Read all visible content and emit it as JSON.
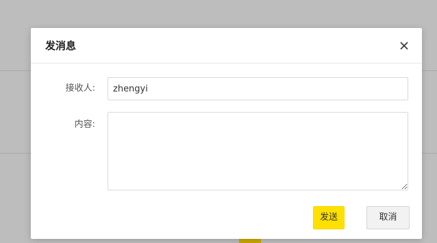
{
  "dialog": {
    "title": "发消息",
    "close_icon": "close-icon"
  },
  "form": {
    "recipient_label": "接收人:",
    "recipient_value": "zhengyi",
    "content_label": "内容:",
    "content_value": ""
  },
  "buttons": {
    "send_label": "发送",
    "cancel_label": "取消"
  },
  "colors": {
    "accent": "#ffe000",
    "overlay": "#bdbdbd"
  }
}
